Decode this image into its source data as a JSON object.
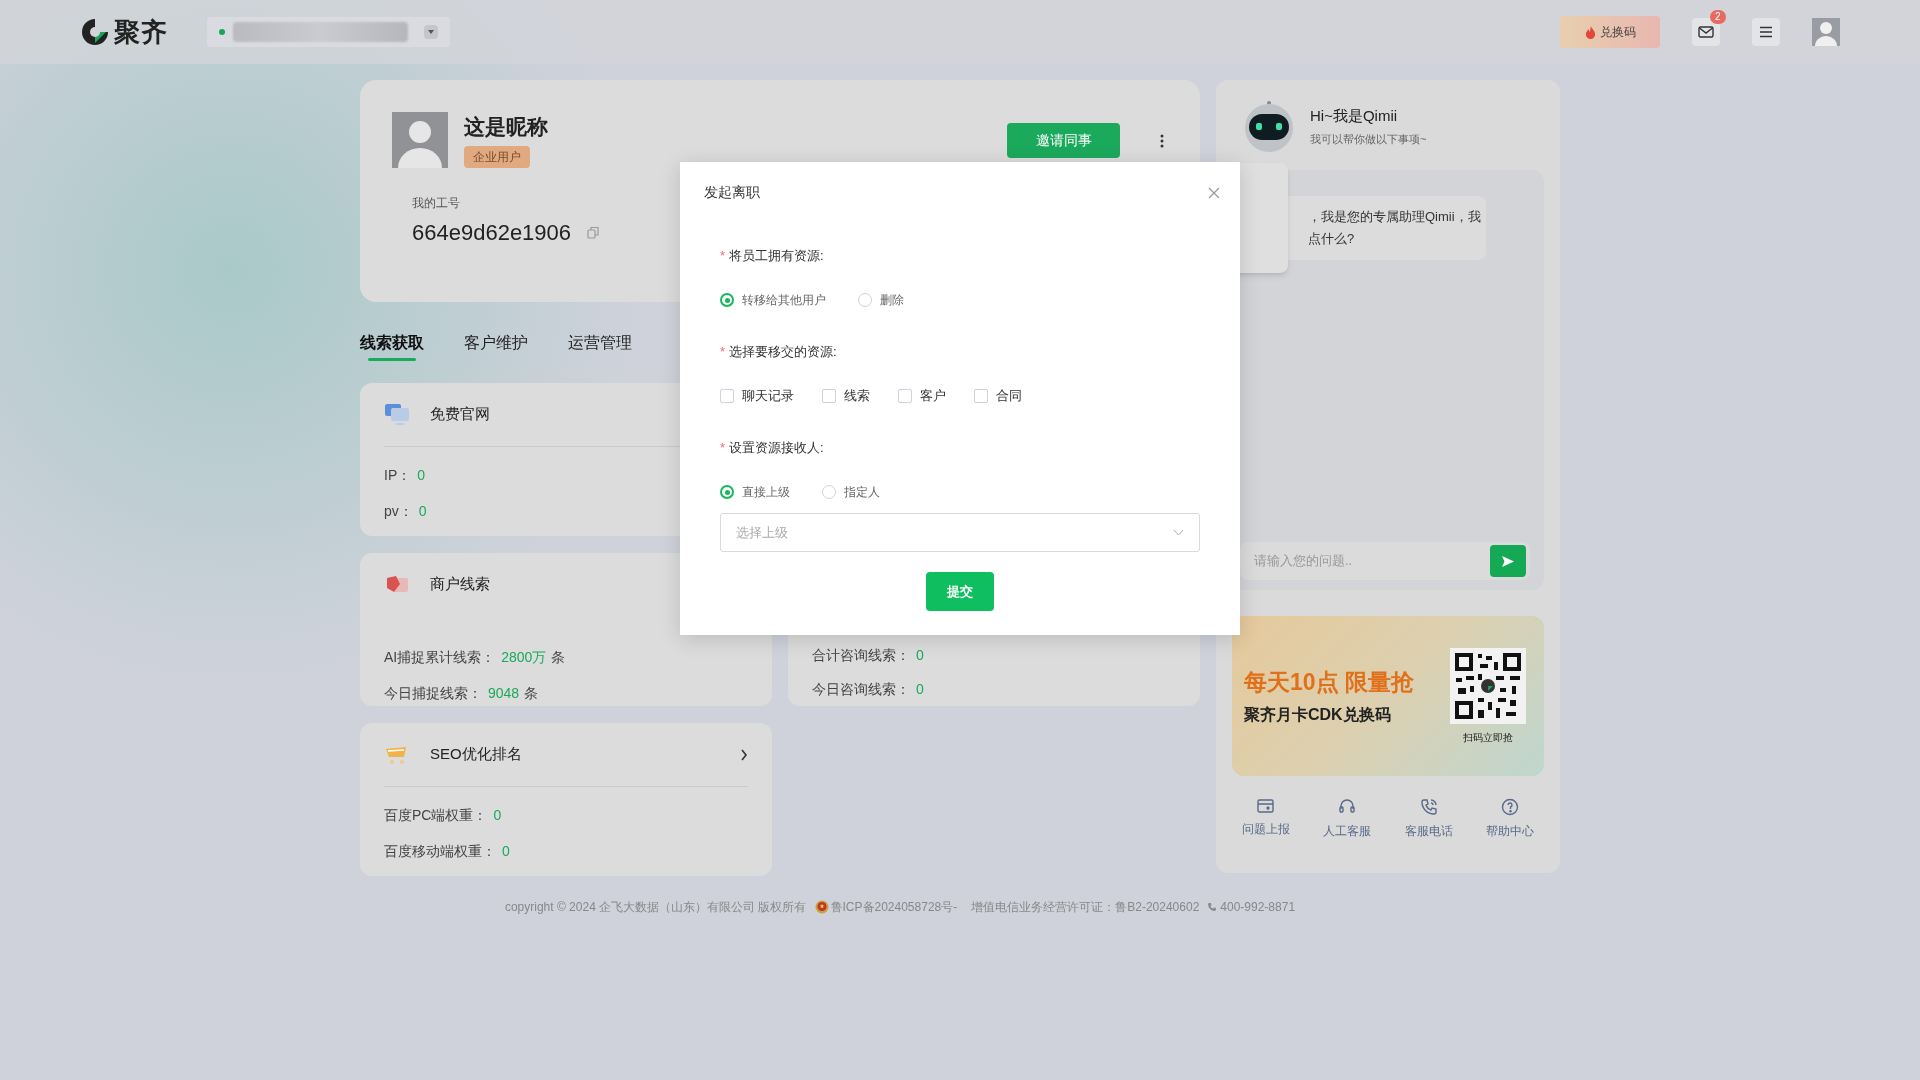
{
  "top_bar": {
    "logo_text": "聚齐",
    "redeem_button": "兑换码",
    "mail_badge": "2"
  },
  "profile": {
    "nickname": "这是昵称",
    "badge": "企业用户",
    "id_label": "我的工号",
    "employee_id": "664e9d62e1906",
    "invite_button": "邀请同事"
  },
  "tabs": [
    {
      "label": "线索获取",
      "selected": true
    },
    {
      "label": "客户维护",
      "selected": false
    },
    {
      "label": "运营管理",
      "selected": false
    }
  ],
  "left_cards": [
    {
      "title": "免费官网",
      "stats": [
        {
          "label": "IP：",
          "value": "0"
        },
        {
          "label": "pv：",
          "value": "0"
        }
      ]
    },
    {
      "title": "商户线索",
      "stats": [
        {
          "label": "AI捕捉累计线索：",
          "value": "2800万",
          "unit": "条"
        },
        {
          "label": "今日捕捉线索：",
          "value": "9048",
          "unit": "条"
        }
      ]
    },
    {
      "title": "SEO优化排名",
      "arrow": true,
      "stats": [
        {
          "label": "百度PC端权重：",
          "value": "0"
        },
        {
          "label": "百度移动端权重：",
          "value": "0"
        }
      ]
    }
  ],
  "consult_card": {
    "stats": [
      {
        "label": "合计咨询线索：",
        "value": "0"
      },
      {
        "label": "今日咨询线索：",
        "value": "0"
      }
    ]
  },
  "assistant": {
    "title": "Hi~我是Qimii",
    "subtitle": "我可以帮你做以下事项~",
    "message_lines": [
      "，我是您的专属助理Qimii，我",
      "点什么?"
    ],
    "input_placeholder": "请输入您的问题.."
  },
  "banner": {
    "headline": "每天10点 限量抢",
    "subline": "聚齐月卡CDK兑换码",
    "qr_caption": "扫码立即抢"
  },
  "quick_links": [
    {
      "label": "问题上报"
    },
    {
      "label": "人工客服"
    },
    {
      "label": "客服电话"
    },
    {
      "label": "帮助中心"
    }
  ],
  "footer": {
    "copyright": "copyright © 2024 企飞大数据（山东）有限公司 版权所有",
    "icp": "鲁ICP备2024058728号-",
    "license": "增值电信业务经营许可证：鲁B2-20240602",
    "phone": "400-992-8871"
  },
  "modal": {
    "title": "发起离职",
    "sections": [
      {
        "required_mark": "*",
        "label": "将员工拥有资源:",
        "kind": "radio",
        "options": [
          {
            "label": "转移给其他用户",
            "selected": true
          },
          {
            "label": "删除",
            "selected": false
          }
        ]
      },
      {
        "required_mark": "*",
        "label": "选择要移交的资源:",
        "kind": "checkbox",
        "options": [
          {
            "label": "聊天记录",
            "checked": false
          },
          {
            "label": "线索",
            "checked": false
          },
          {
            "label": "客户",
            "checked": false
          },
          {
            "label": "合同",
            "checked": false
          }
        ]
      },
      {
        "required_mark": "*",
        "label": "设置资源接收人:",
        "kind": "radio",
        "options": [
          {
            "label": "直接上级",
            "selected": true
          },
          {
            "label": "指定人",
            "selected": false
          }
        ],
        "select": {
          "placeholder": "选择上级"
        }
      }
    ],
    "submit_button": "提交"
  }
}
